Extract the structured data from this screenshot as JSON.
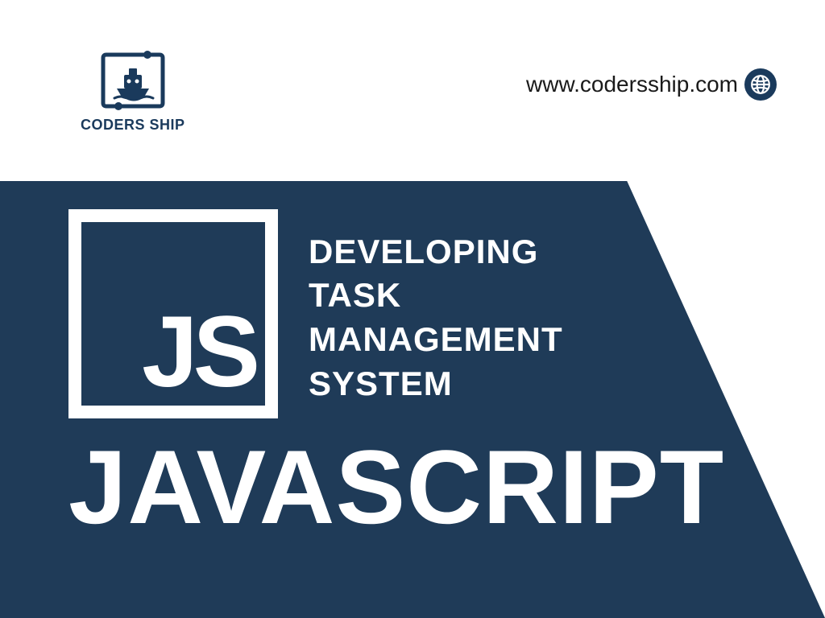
{
  "brand": {
    "name": "CODERS SHIP"
  },
  "url": "www.codersship.com",
  "badge": {
    "label": "JS"
  },
  "headline": {
    "line1": "DEVELOPING",
    "line2": "TASK",
    "line3": "MANAGEMENT",
    "line4": "SYSTEM"
  },
  "main_title": "JAVASCRIPT",
  "colors": {
    "primary": "#1f3b58",
    "accent": "#1a3a5c"
  }
}
